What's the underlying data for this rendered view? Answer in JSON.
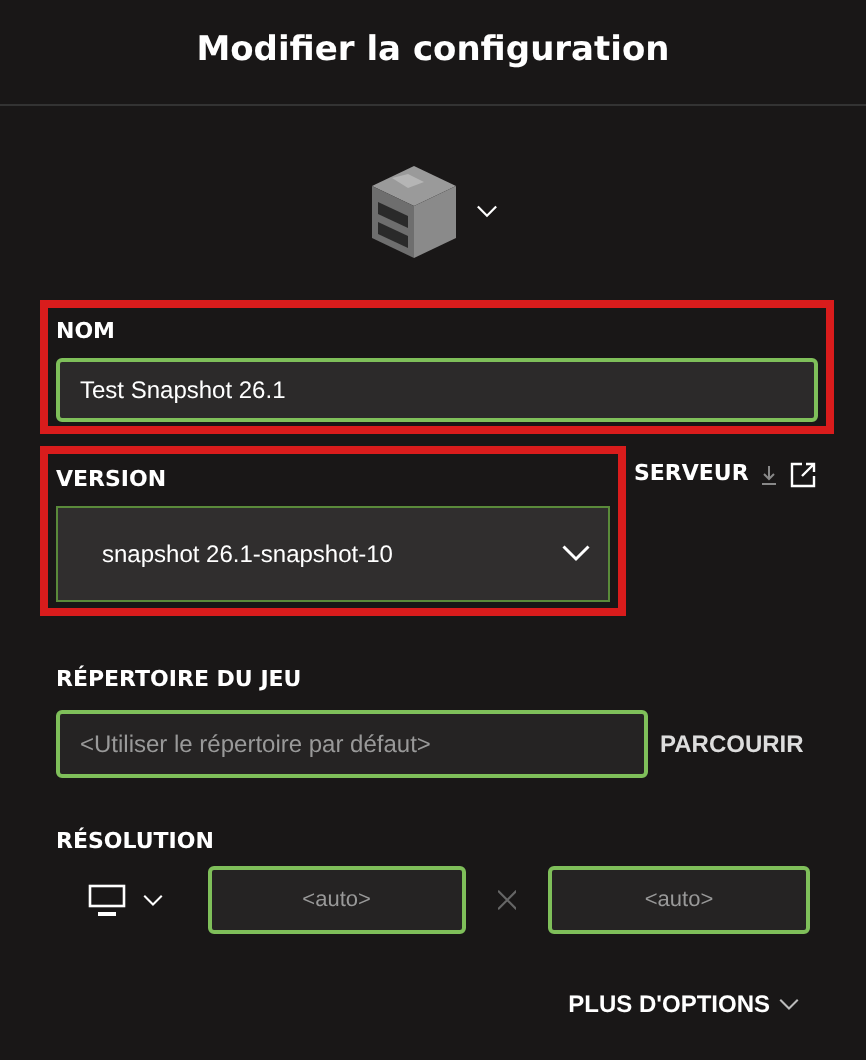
{
  "window": {
    "title": "Modifier la configuration"
  },
  "name": {
    "label": "NOM",
    "value": "Test Snapshot 26.1",
    "highlighted": true
  },
  "version": {
    "label": "VERSION",
    "value": "snapshot 26.1-snapshot-10",
    "highlighted": true,
    "server_link": "SERVEUR"
  },
  "game_directory": {
    "label": "RÉPERTOIRE DU JEU",
    "placeholder": "<Utiliser le répertoire par défaut>",
    "browse": "PARCOURIR"
  },
  "resolution": {
    "label": "RÉSOLUTION",
    "width_placeholder": "<auto>",
    "height_placeholder": "<auto>"
  },
  "more_options": "PLUS D'OPTIONS"
}
